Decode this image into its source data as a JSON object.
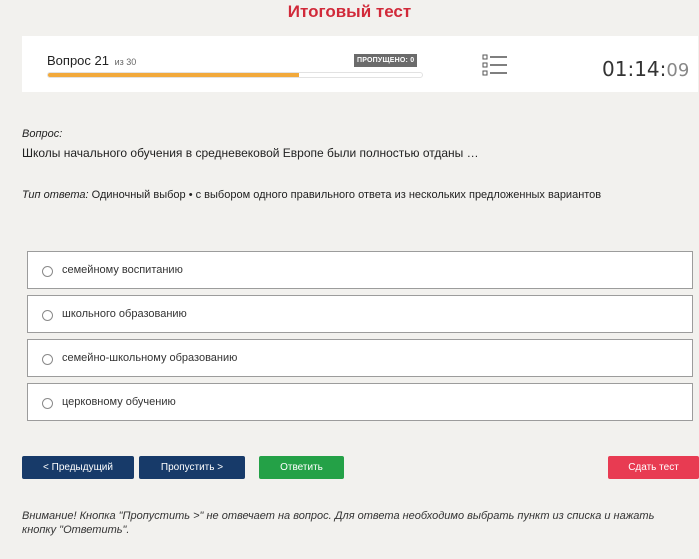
{
  "page": {
    "title": "Итоговый тест"
  },
  "header": {
    "question_label": "Вопрос 21",
    "question_of": "из 30",
    "skipped_badge": "ПРОПУЩЕНО: 0",
    "progress_fraction": 0.67,
    "progress_color": "#f2a93b",
    "timer_main": "01:14:",
    "timer_seconds": "09",
    "list_icon": "question-list-icon"
  },
  "question": {
    "caption": "Вопрос:",
    "text": "Школы начального обучения в средневековой Европе были полностью отданы …",
    "type_label": "Тип ответа:",
    "type_value": " Одиночный выбор • с выбором одного правильного ответа из нескольких предложенных вариантов"
  },
  "options": [
    {
      "label": "семейному воспитанию"
    },
    {
      "label": "школьного образованию"
    },
    {
      "label": "семейно-школьному образованию"
    },
    {
      "label": "церковному обучению"
    }
  ],
  "buttons": {
    "prev": "< Предыдущий",
    "skip": "Пропустить >",
    "answer": "Ответить",
    "submit": "Сдать тест"
  },
  "colors": {
    "title": "#d12a3a",
    "nav_button": "#173a69",
    "answer_button": "#24a147",
    "submit_button": "#e83b52"
  },
  "warning": "Внимание! Кнопка \"Пропустить >\" не отвечает на вопрос. Для ответа необходимо выбрать пункт из списка и нажать кнопку \"Ответить\"."
}
